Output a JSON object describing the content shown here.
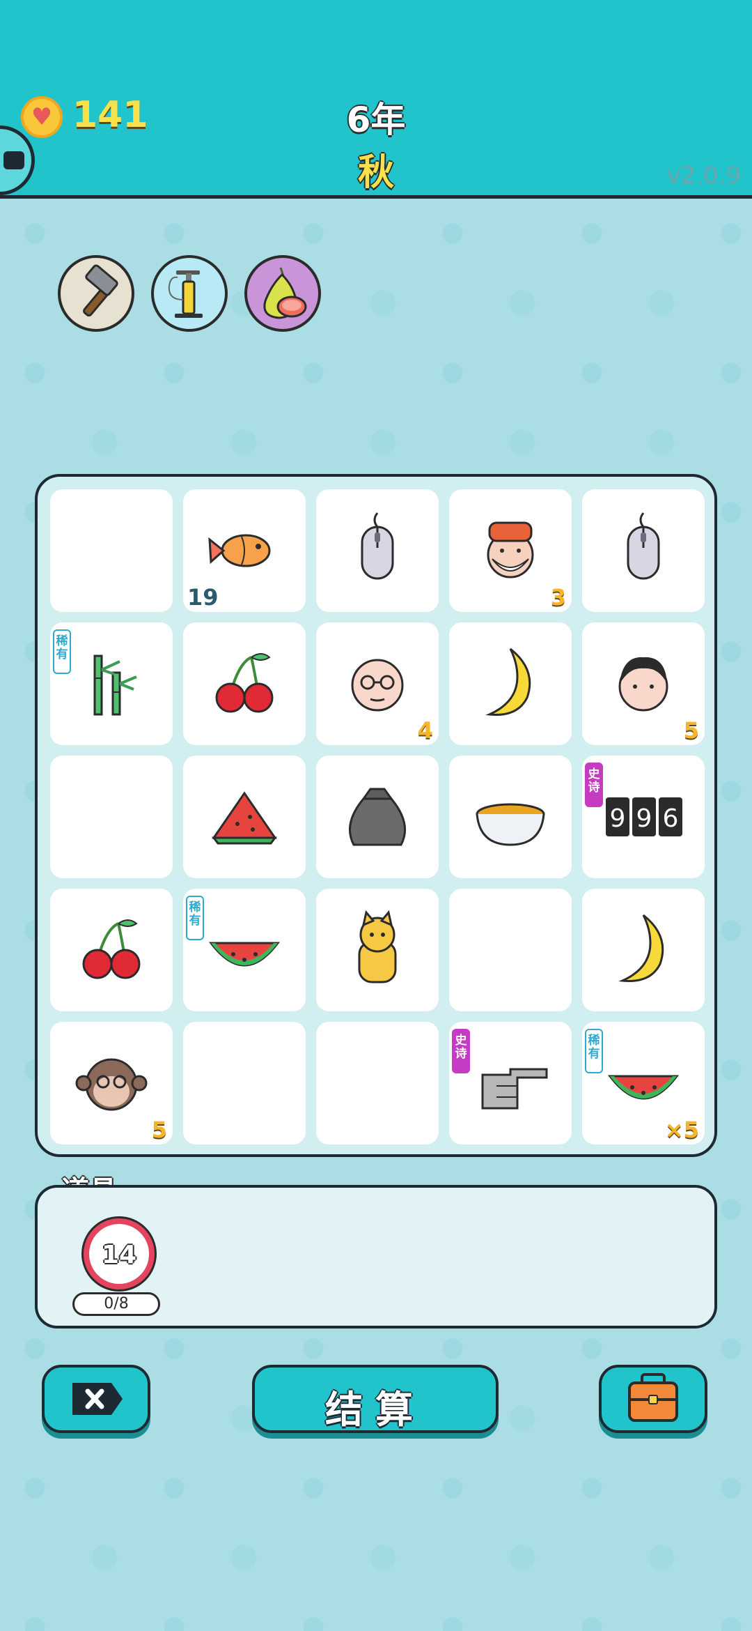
{
  "header": {
    "coins": "141",
    "year": "6年",
    "season": "秋",
    "version": "v2.0.9"
  },
  "tools": [
    {
      "name": "hammer-icon"
    },
    {
      "name": "air-pump-icon"
    },
    {
      "name": "pomelo-icon"
    }
  ],
  "grid": {
    "rows": [
      [
        {
          "item": "empty"
        },
        {
          "item": "fish",
          "count": "19"
        },
        {
          "item": "mouse"
        },
        {
          "item": "old-man",
          "count": "3"
        },
        {
          "item": "mouse"
        }
      ],
      [
        {
          "item": "bamboo",
          "badge": "稀有"
        },
        {
          "item": "cherry"
        },
        {
          "item": "bald-man",
          "count": "4"
        },
        {
          "item": "banana"
        },
        {
          "item": "man",
          "count": "5"
        }
      ],
      [
        {
          "item": "empty"
        },
        {
          "item": "watermelon-slice"
        },
        {
          "item": "garbage-bag"
        },
        {
          "item": "soup-bowl"
        },
        {
          "item": "counter-996",
          "badge": "史诗"
        }
      ],
      [
        {
          "item": "cherry"
        },
        {
          "item": "watermelon",
          "badge": "稀有"
        },
        {
          "item": "cat"
        },
        {
          "item": "empty"
        },
        {
          "item": "banana"
        }
      ],
      [
        {
          "item": "monkey",
          "count": "5"
        },
        {
          "item": "empty"
        },
        {
          "item": "empty"
        },
        {
          "item": "pointing-hand",
          "badge": "史诗"
        },
        {
          "item": "watermelon",
          "badge": "稀有",
          "count": "×5"
        }
      ]
    ]
  },
  "props": {
    "label": "道具",
    "dart_count": "14",
    "dart_progress": "0/8"
  },
  "buttons": {
    "settle_label": "结算"
  },
  "colors": {
    "header_bg": "#22C4CB",
    "page_bg": "#ABDDE5",
    "count": "#F7B42C"
  }
}
